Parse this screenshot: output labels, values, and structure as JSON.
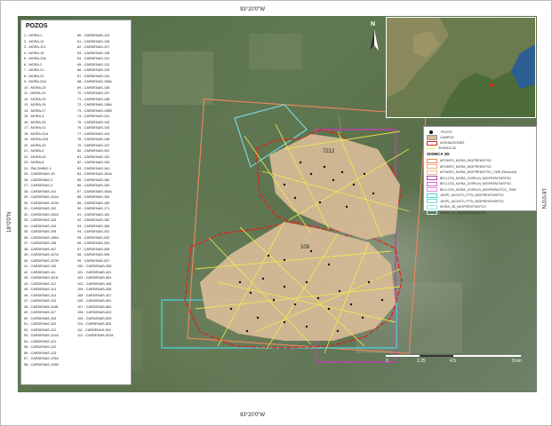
{
  "coords": {
    "top": "93°20'0\"W",
    "bottom": "93°20'0\"W",
    "left": "18°0'0\"N",
    "right": "18°0'0\"N"
  },
  "pozos": {
    "title": "POZOS",
    "col1": [
      "1 - MORA-1",
      "2 - MORA-12",
      "3 - MORA-121",
      "4 - MORA-15",
      "5 - MORA-13A",
      "6 - MORA-2",
      "7 - MORA-21",
      "8 - MORA-22",
      "9 - MORA-22A",
      "10 - MORA-23",
      "11 - MORA-24",
      "12 - MORA-25",
      "13 - MORA-26",
      "14 - MORA-27",
      "15 - MORA-3",
      "16 - MORA-33",
      "17 - MORA-41",
      "18 - MORA-41A",
      "19 - MORA-41B",
      "20 - MORA-42",
      "21 - MORA-4",
      "22 - MORA-43",
      "23 - MORA-6",
      "24 - PALOMINO-1",
      "25 - CARDENAS-1R",
      "26 - CARDENAS-2",
      "27 - CARDENAS-3",
      "28 - CARDENAS-101",
      "29 - CARDENAS-101A",
      "30 - CARDENAS-101B",
      "31 - CARDENAS-102",
      "32 - CARDENAS-102A",
      "33 - CARDENAS-103",
      "34 - CARDENAS-104",
      "35 - CARDENAS-105",
      "36 - CARDENAS-105A",
      "37 - CARDENAS-106",
      "38 - CARDENAS-107",
      "39 - CARDENAS-107A",
      "40 - CARDENAS-107B",
      "41 - CARDENAS-109",
      "42 - CARDENAS-111",
      "43 - CARDENAS-111A",
      "44 - CARDENAS-112",
      "45 - CARDENAS-113",
      "46 - CARDENAS-114",
      "47 - CARDENAS-115",
      "48 - CARDENAS-116B",
      "49 - CARDENAS-117",
      "50 - CARDENAS-118",
      "51 - CARDENAS-119",
      "52 - CARDENAS-121",
      "53 - CARDENAS-121A",
      "54 - CARDENAS-121",
      "55 - CARDENAS-122",
      "56 - CARDENAS-123",
      "57 - CARDENAS-123A",
      "58 - CARDENAS-123B"
    ],
    "col2": [
      "60 - CARDENAS-124",
      "61 - CARDENAS-125",
      "62 - CARDENAS-127",
      "63 - CARDENAS-128",
      "64 - CARDENAS-131",
      "65 - CARDENAS-132",
      "66 - CARDENAS-133",
      "67 - CARDENAS-134",
      "68 - CARDENAS-135A",
      "69 - CARDENAS-136",
      "70 - CARDENAS-137",
      "71 - CARDENAS-138",
      "72 - CARDENAS-138A",
      "73 - CARDENAS-138B",
      "74 - CARDENAS-141",
      "75 - CARDENAS-142",
      "76 - CARDENAS-143",
      "77 - CARDENAS-144",
      "78 - CARDENAS-146",
      "79 - CARDENAS-147",
      "80 - CARDENAS-151",
      "81 - CARDENAS-152",
      "82 - CARDENAS-153",
      "83 - CARDENAS-161",
      "84 - CARDENAS-161A",
      "85 - CARDENAS-162",
      "86 - CARDENAS-163",
      "87 - CARDENAS-163A",
      "88 - CARDENAS-164",
      "89 - CARDENAS-165",
      "90 - CARDENAS-171",
      "91 - CARDENAS-181",
      "92 - CARDENAS-182",
      "93 - CARDENAS-183",
      "94 - CARDENAS-201",
      "95 - CARDENAS-202",
      "96 - CARDENAS-204",
      "97 - CARDENAS-305",
      "98 - CARDENAS-306",
      "99 - CARDENAS-307",
      "100 - CARDENAS-308",
      "101 - CARDENAS-401",
      "102 - CARDENAS-504",
      "103 - CARDENAS-406",
      "104 - CARDENAS-408",
      "105 - CARDENAS-427",
      "106 - CARDENAS-501",
      "107 - CARDENAS-802",
      "108 - CARDENAS-812",
      "109 - CARDENAS-825",
      "110 - CARDENAS-826",
      "111 - CARDENAS-901",
      "112 - CARDENAS-912A"
    ]
  },
  "legend": {
    "items": [
      {
        "label": "POZOS",
        "color": "#111111",
        "kind": "dot"
      },
      {
        "label": "CAMPOS",
        "color": "#d8bc98",
        "kind": "fill"
      },
      {
        "label": "ASIGNACIONES",
        "color": "#d9261c",
        "kind": "outline"
      },
      {
        "label": "SISMICA 2D",
        "color": "#f2ec4a",
        "kind": "line"
      }
    ],
    "heading": "SISMICA 3D",
    "surveys": [
      {
        "label": "APOMPO_MORA_MIGPREMCFSG",
        "color": "#e8875c"
      },
      {
        "label": "APOMPO_MORA_MIGPREMCFSG",
        "color": "#f2a37a"
      },
      {
        "label": "APOMPO_MORA_MIGPREMCFSG_TIME (Reduced)",
        "color": "#f5b892"
      },
      {
        "label": "BELLOTA_MORA_CHIPILIN_MIGPREMTMSFSG",
        "color": "#c23fb8"
      },
      {
        "label": "BELLOTA_MORA_CHIPILIN_MIGPREMTMSFSG",
        "color": "#d866cd"
      },
      {
        "label": "BELLOTA_MORA_CHIPILIN_MIGPREMCFCO_TIME",
        "color": "#e58fdb"
      },
      {
        "label": "JUSPI_JACINTO_PTSI_MIGPREMTMSFSG",
        "color": "#4ecbd1"
      },
      {
        "label": "JUSPI_JACINTO_PTSI_MIGPREMTMSFSG",
        "color": "#74d9de"
      },
      {
        "label": "MORA_3D_MIGPREMTMCFCO",
        "color": "#9ae3e6"
      },
      {
        "label": "MORA_3D_MIGPREMTMSFSG",
        "color": "#b6ecee"
      }
    ]
  },
  "north": {
    "label": "N"
  },
  "scale": {
    "labels": [
      "0",
      "2.25",
      "4.5",
      "9 km"
    ]
  },
  "map_labels": {
    "field_a": "7212",
    "field_b": "109"
  }
}
